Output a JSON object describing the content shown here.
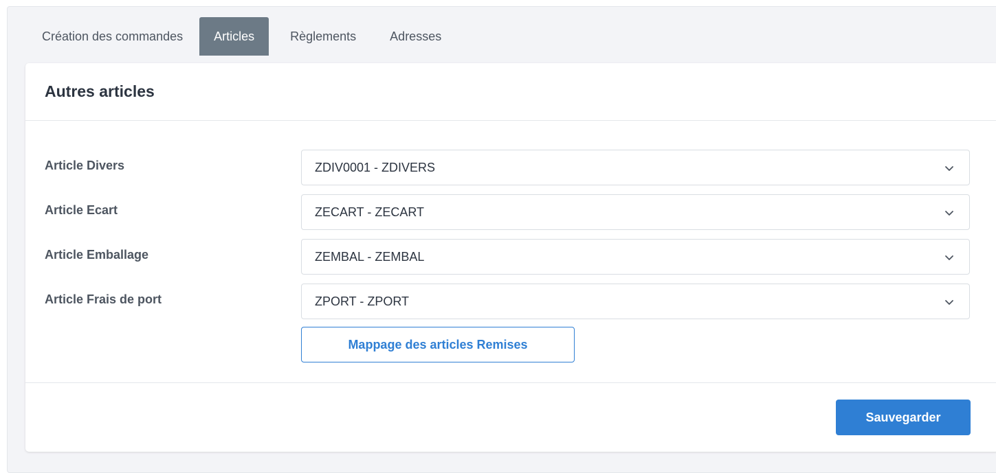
{
  "tabs": [
    {
      "label": "Création des commandes",
      "active": false
    },
    {
      "label": "Articles",
      "active": true
    },
    {
      "label": "Règlements",
      "active": false
    },
    {
      "label": "Adresses",
      "active": false
    }
  ],
  "card": {
    "title": "Autres articles"
  },
  "fields": [
    {
      "label": "Article Divers",
      "value": "ZDIV0001 - ZDIVERS"
    },
    {
      "label": "Article Ecart",
      "value": "ZECART - ZECART"
    },
    {
      "label": "Article Emballage",
      "value": "ZEMBAL - ZEMBAL"
    },
    {
      "label": "Article Frais de port",
      "value": "ZPORT - ZPORT"
    }
  ],
  "buttons": {
    "mapping_label": "Mappage des articles Remises",
    "save_label": "Sauvegarder"
  },
  "colors": {
    "accent": "#2f7fd4",
    "active_tab": "#6c7a86"
  },
  "icons": {
    "select_caret": "chevron-down-icon"
  }
}
